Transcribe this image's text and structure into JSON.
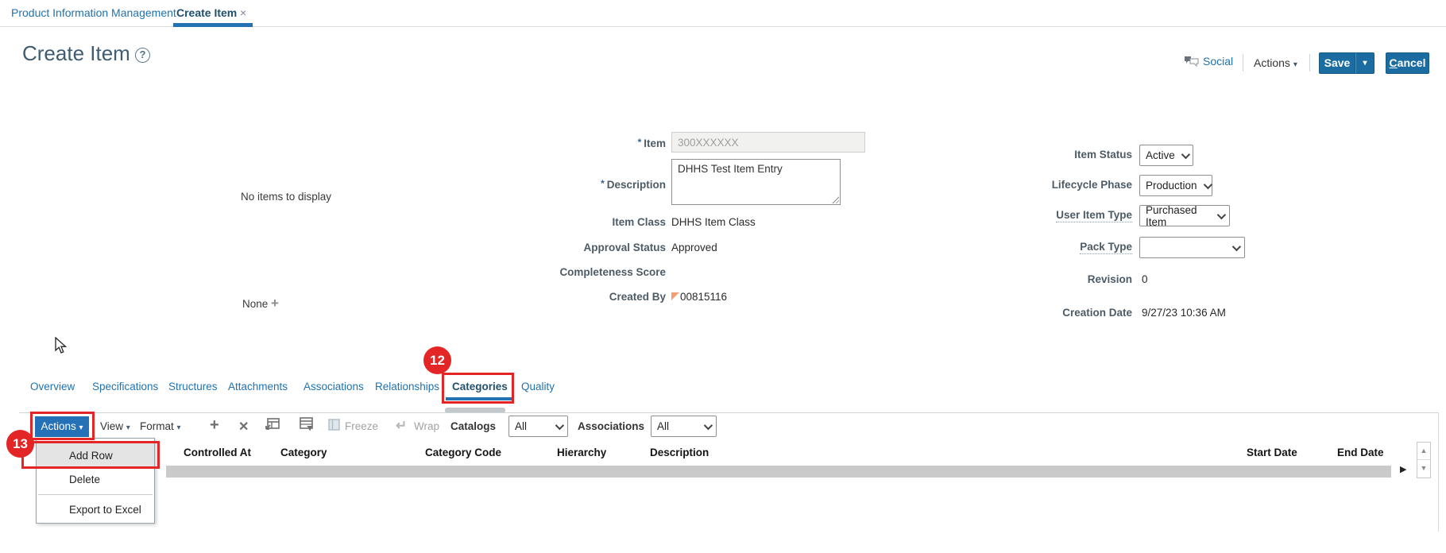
{
  "window_tabs": {
    "back_tab": "Product Information Management",
    "active_tab": "Create Item"
  },
  "header": {
    "title": "Create Item",
    "social_label": "Social",
    "actions_label": "Actions",
    "save_label": "Save",
    "cancel_accesskey": "C",
    "cancel_suffix": "ancel"
  },
  "form": {
    "left_panel": {
      "empty_text": "No items to display",
      "attachments_value": "None"
    },
    "item": {
      "label": "Item",
      "value": "300XXXXXX"
    },
    "description": {
      "label": "Description",
      "value": "DHHS Test Item Entry"
    },
    "item_class": {
      "label": "Item Class",
      "value": "DHHS Item Class"
    },
    "approval_status": {
      "label": "Approval Status",
      "value": "Approved"
    },
    "completeness_score": {
      "label": "Completeness Score",
      "value": ""
    },
    "created_by": {
      "label": "Created By",
      "value": "00815116"
    },
    "item_status": {
      "label": "Item Status",
      "value": "Active"
    },
    "lifecycle_phase": {
      "label": "Lifecycle Phase",
      "value": "Production"
    },
    "user_item_type": {
      "label": "User Item Type",
      "value": "Purchased Item"
    },
    "pack_type": {
      "label": "Pack Type",
      "value": ""
    },
    "revision": {
      "label": "Revision",
      "value": "0"
    },
    "creation_date": {
      "label": "Creation Date",
      "value": "9/27/23 10:36 AM"
    }
  },
  "subtabs": {
    "items": [
      "Overview",
      "Specifications",
      "Structures",
      "Attachments",
      "Associations",
      "Relationships",
      "Categories",
      "Quality"
    ],
    "selected": "Categories"
  },
  "table": {
    "toolbar": {
      "actions_label": "Actions",
      "view_label": "View",
      "format_label": "Format",
      "freeze_label": "Freeze",
      "wrap_label": "Wrap",
      "catalogs_label": "Catalogs",
      "catalogs_value": "All",
      "associations_label": "Associations",
      "associations_value": "All"
    },
    "menu": {
      "items": [
        "Add Row",
        "Delete",
        "Export to Excel"
      ],
      "highlighted": "Add Row"
    },
    "columns": [
      "Controlled At",
      "Category",
      "Category Code",
      "Hierarchy",
      "Description",
      "Start Date",
      "End Date"
    ]
  },
  "annotations": {
    "categories_step": "12",
    "actions_step": "13",
    "color": "#e32526"
  },
  "glyphs": {
    "close": "×",
    "help": "?",
    "caret": "▾",
    "asterisk": "*",
    "plus": "+",
    "delete_x": "✕",
    "wrap_arrow": "↵",
    "right_arrow": "▶",
    "scroll_up": "▲",
    "scroll_down": "▼"
  }
}
